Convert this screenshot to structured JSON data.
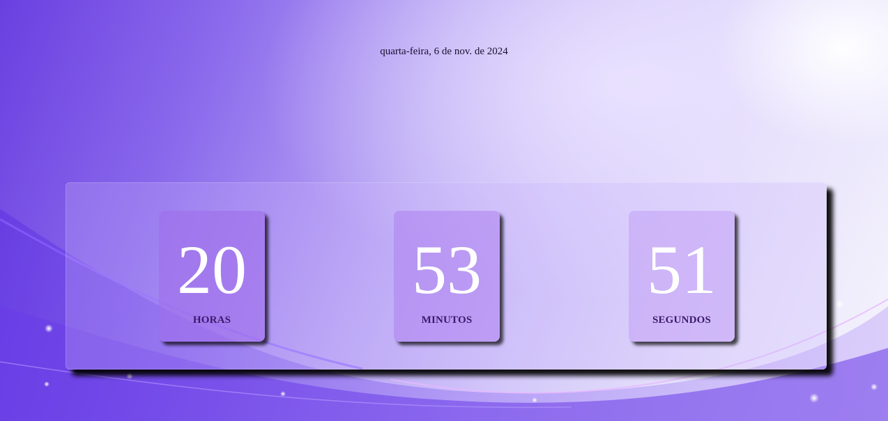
{
  "date_text": "quarta-feira, 6 de nov. de 2024",
  "countdown": [
    {
      "value": "20",
      "label": "HORAS"
    },
    {
      "value": "53",
      "label": "MINUTOS"
    },
    {
      "value": "51",
      "label": "SEGUNDOS"
    }
  ],
  "colors": {
    "accent": "#6a3fe0",
    "label": "#3a1a6b",
    "number": "#ffffff"
  }
}
